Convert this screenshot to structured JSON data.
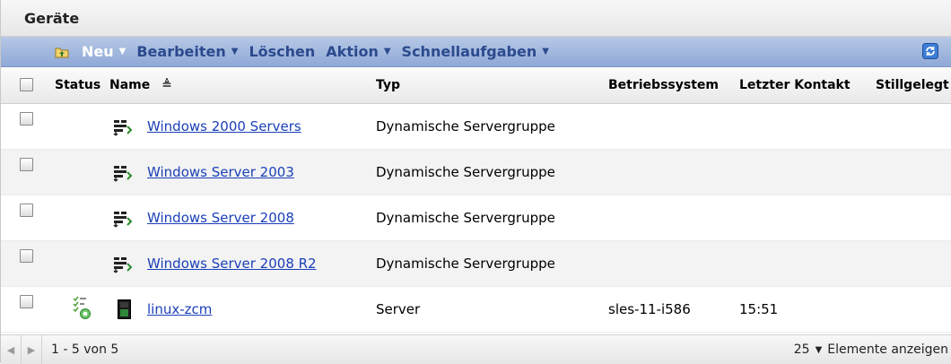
{
  "panel_title": "Geräte",
  "toolbar": {
    "new_label": "Neu",
    "edit_label": "Bearbeiten",
    "delete_label": "Löschen",
    "action_label": "Aktion",
    "quicktasks_label": "Schnellaufgaben"
  },
  "columns": {
    "status": "Status",
    "name": "Name",
    "name_sort": "≜",
    "typ": "Typ",
    "os": "Betriebssystem",
    "last_contact": "Letzter Kontakt",
    "retired": "Stillgelegt"
  },
  "rows": [
    {
      "name": "Windows 2000 Servers",
      "typ": "Dynamische Servergruppe",
      "os": "",
      "last": "",
      "icon": "server-group-icon"
    },
    {
      "name": "Windows Server 2003",
      "typ": "Dynamische Servergruppe",
      "os": "",
      "last": "",
      "icon": "server-group-icon"
    },
    {
      "name": "Windows Server 2008",
      "typ": "Dynamische Servergruppe",
      "os": "",
      "last": "",
      "icon": "server-group-icon"
    },
    {
      "name": "Windows Server 2008 R2",
      "typ": "Dynamische Servergruppe",
      "os": "",
      "last": "",
      "icon": "server-group-icon"
    },
    {
      "name": "linux-zcm",
      "typ": "Server",
      "os": "sles-11-i586",
      "last": "15:51",
      "icon": "server-icon",
      "status_icon": "status-ok-icon"
    }
  ],
  "footer": {
    "range": "1 - 5 von 5",
    "page_size": "25",
    "page_size_label": "Elemente anzeigen"
  },
  "colors": {
    "toolbar_text": "#2c4a8e",
    "link": "#1a3fb8",
    "toolbar_bg": "#9db3dc"
  }
}
